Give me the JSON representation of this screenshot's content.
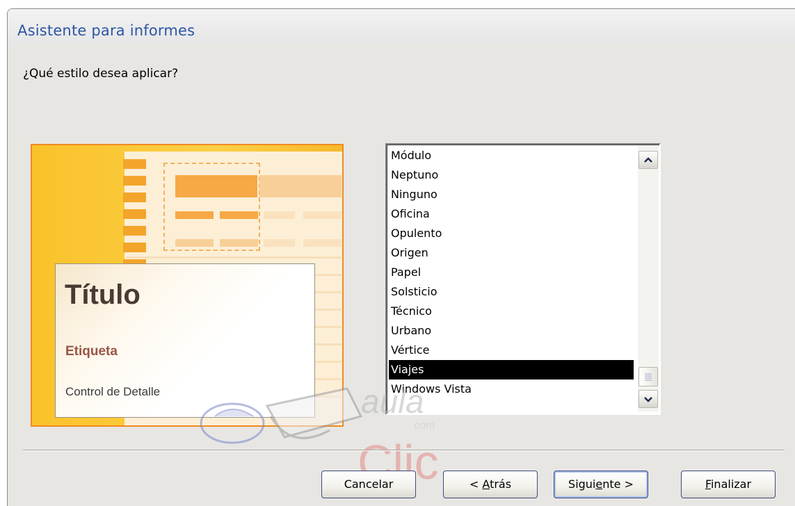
{
  "window": {
    "title": "Asistente para informes"
  },
  "prompt": {
    "question": "¿Qué estilo desea aplicar?"
  },
  "preview": {
    "title": "Título",
    "label": "Etiqueta",
    "detail": "Control de Detalle"
  },
  "styles_list": {
    "items": [
      "Módulo",
      "Neptuno",
      "Ninguno",
      "Oficina",
      "Opulento",
      "Origen",
      "Papel",
      "Solsticio",
      "Técnico",
      "Urbano",
      "Vértice",
      "Viajes",
      "Windows Vista"
    ],
    "selected": "Viajes",
    "scroll_up_icon": "chevron-up-icon",
    "scroll_down_icon": "chevron-down-icon"
  },
  "buttons": {
    "cancel": "Cancelar",
    "back_prefix": "< ",
    "back_mnemonic": "A",
    "back_rest": "trás",
    "next_prefix": "Sigui",
    "next_mnemonic": "e",
    "next_rest": "nte >",
    "finish_mnemonic": "F",
    "finish_rest": "inalizar"
  },
  "watermark": {
    "text_top": "aula",
    "text_small": "com",
    "text_bottom": "Clic"
  },
  "colors": {
    "title_blue": "#2c55a6",
    "preview_orange": "#f08a23",
    "selected_bg": "#000000",
    "label_brown": "#985644"
  }
}
